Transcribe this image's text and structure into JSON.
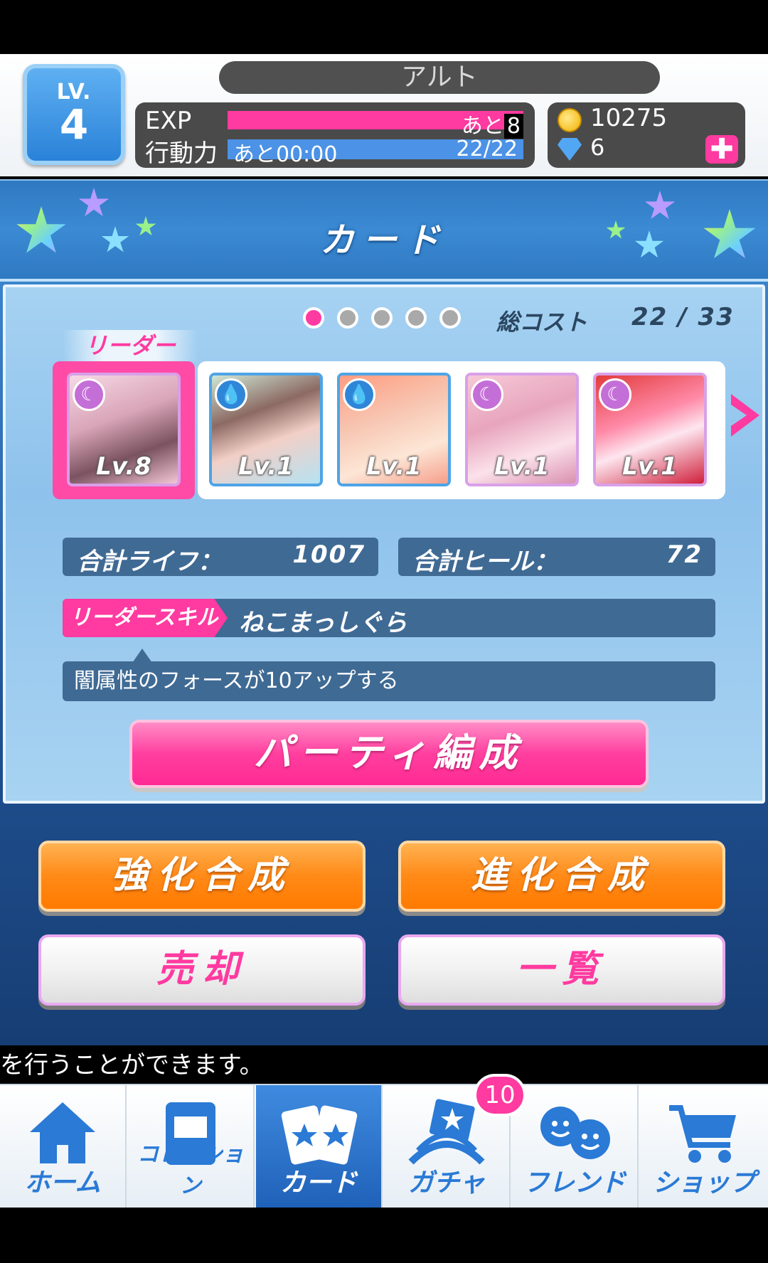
{
  "header": {
    "level_label": "LV.",
    "level_value": "4",
    "player_name": "アルト",
    "exp_label": "EXP",
    "exp_remaining_prefix": "あと",
    "exp_remaining_value": "8",
    "ap_label": "行動力",
    "ap_timer": "あと00:00",
    "ap_value": "22/22",
    "coins": "10275",
    "gems": "6",
    "add_icon": "plus-icon"
  },
  "title": "カード",
  "party": {
    "total_cost_label": "総コスト",
    "total_cost_value": "22 / 33",
    "page_dots": 5,
    "active_page": 1,
    "leader_label": "リーダー",
    "cards": [
      {
        "level": "Lv.8",
        "attribute": "moon",
        "attribute_color": "#c46fd8"
      },
      {
        "level": "Lv.1",
        "attribute": "water",
        "attribute_color": "#2f86d8"
      },
      {
        "level": "Lv.1",
        "attribute": "water",
        "attribute_color": "#2f86d8"
      },
      {
        "level": "Lv.1",
        "attribute": "moon",
        "attribute_color": "#c46fd8"
      },
      {
        "level": "Lv.1",
        "attribute": "moon",
        "attribute_color": "#c46fd8"
      }
    ],
    "total_life_label": "合計ライフ：",
    "total_life_value": "1007",
    "total_heal_label": "合計ヒール：",
    "total_heal_value": "72",
    "leader_skill_label": "リーダースキル",
    "leader_skill_name": "ねこまっしぐら",
    "leader_skill_desc": "闇属性のフォースが10アップする",
    "party_button": "パーティ編成"
  },
  "actions": {
    "enhance": "強化合成",
    "evolve": "進化合成",
    "sell": "売却",
    "list": "一覧"
  },
  "ticker": "を行うことができます。",
  "nav": {
    "items": [
      {
        "label": "ホーム",
        "icon": "home-icon"
      },
      {
        "label": "コレクション",
        "icon": "book-icon"
      },
      {
        "label": "カード",
        "icon": "cards-icon"
      },
      {
        "label": "ガチャ",
        "icon": "gacha-icon"
      },
      {
        "label": "フレンド",
        "icon": "friends-icon"
      },
      {
        "label": "ショップ",
        "icon": "cart-icon"
      }
    ],
    "active_index": 2,
    "gacha_badge": "10"
  },
  "colors": {
    "accent_pink": "#ff3aa0",
    "accent_blue": "#2a7ad6",
    "accent_orange": "#ff8a17"
  }
}
